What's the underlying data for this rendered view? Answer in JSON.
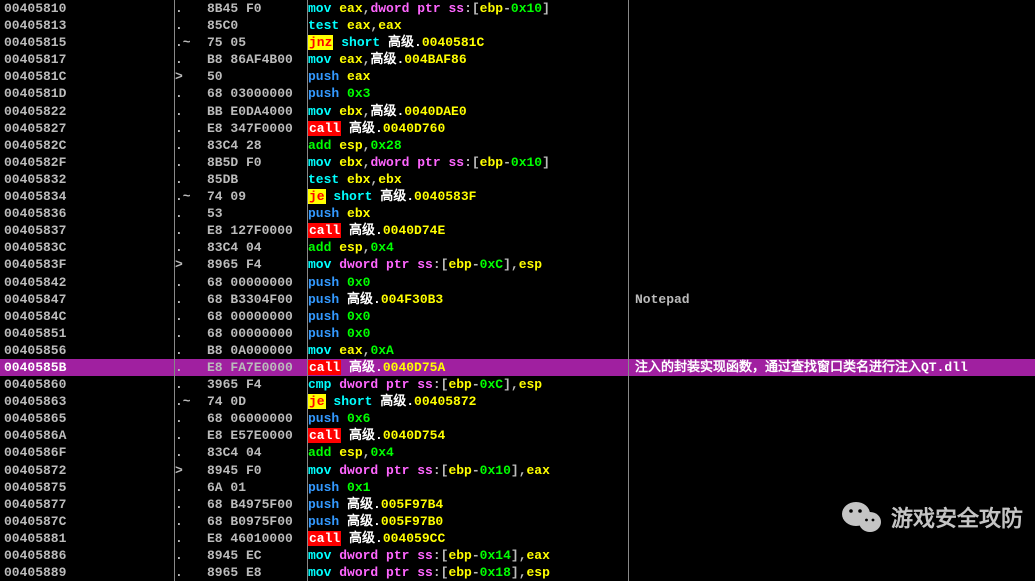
{
  "rows": [
    {
      "addr": "00405810",
      "mark": ".",
      "bytes": "8B45 F0",
      "d": [
        [
          "cyan",
          "mov "
        ],
        [
          "yellow",
          "eax"
        ],
        [
          "gray",
          ","
        ],
        [
          "pink",
          "dword ptr ss"
        ],
        [
          "gray",
          ":["
        ],
        [
          "yellow",
          "ebp"
        ],
        [
          "gray",
          "-"
        ],
        [
          "green",
          "0x10"
        ],
        [
          "gray",
          "]"
        ]
      ],
      "c": ""
    },
    {
      "addr": "00405813",
      "mark": ".",
      "bytes": "85C0",
      "d": [
        [
          "cyan",
          "test "
        ],
        [
          "yellow",
          "eax"
        ],
        [
          "gray",
          ","
        ],
        [
          "yellow",
          "eax"
        ]
      ],
      "c": ""
    },
    {
      "addr": "00405815",
      "mark": ".~",
      "bytes": "75 05",
      "d": [
        [
          "box-jnz",
          "jnz"
        ],
        [
          "gray",
          " "
        ],
        [
          "cyan",
          "short "
        ],
        [
          "white",
          "高级."
        ],
        [
          "yellow",
          "0040581C"
        ]
      ],
      "c": ""
    },
    {
      "addr": "00405817",
      "mark": ".",
      "bytes": "B8 86AF4B00",
      "d": [
        [
          "cyan",
          "mov "
        ],
        [
          "yellow",
          "eax"
        ],
        [
          "gray",
          ","
        ],
        [
          "white",
          "高级."
        ],
        [
          "yellow",
          "004BAF86"
        ]
      ],
      "c": ""
    },
    {
      "addr": "0040581C",
      "mark": ">",
      "bytes": "50",
      "d": [
        [
          "blue",
          "push "
        ],
        [
          "yellow",
          "eax"
        ]
      ],
      "c": ""
    },
    {
      "addr": "0040581D",
      "mark": ".",
      "bytes": "68 03000000",
      "d": [
        [
          "blue",
          "push "
        ],
        [
          "green",
          "0x3"
        ]
      ],
      "c": ""
    },
    {
      "addr": "00405822",
      "mark": ".",
      "bytes": "BB E0DA4000",
      "d": [
        [
          "cyan",
          "mov "
        ],
        [
          "yellow",
          "ebx"
        ],
        [
          "gray",
          ","
        ],
        [
          "white",
          "高级."
        ],
        [
          "yellow",
          "0040DAE0"
        ]
      ],
      "c": ""
    },
    {
      "addr": "00405827",
      "mark": ".",
      "bytes": "E8 347F0000",
      "d": [
        [
          "box-call",
          "call"
        ],
        [
          "gray",
          " "
        ],
        [
          "white",
          "高级."
        ],
        [
          "yellow",
          "0040D760"
        ]
      ],
      "c": ""
    },
    {
      "addr": "0040582C",
      "mark": ".",
      "bytes": "83C4 28",
      "d": [
        [
          "green",
          "add "
        ],
        [
          "yellow",
          "esp"
        ],
        [
          "gray",
          ","
        ],
        [
          "green",
          "0x28"
        ]
      ],
      "c": ""
    },
    {
      "addr": "0040582F",
      "mark": ".",
      "bytes": "8B5D F0",
      "d": [
        [
          "cyan",
          "mov "
        ],
        [
          "yellow",
          "ebx"
        ],
        [
          "gray",
          ","
        ],
        [
          "pink",
          "dword ptr ss"
        ],
        [
          "gray",
          ":["
        ],
        [
          "yellow",
          "ebp"
        ],
        [
          "gray",
          "-"
        ],
        [
          "green",
          "0x10"
        ],
        [
          "gray",
          "]"
        ]
      ],
      "c": ""
    },
    {
      "addr": "00405832",
      "mark": ".",
      "bytes": "85DB",
      "d": [
        [
          "cyan",
          "test "
        ],
        [
          "yellow",
          "ebx"
        ],
        [
          "gray",
          ","
        ],
        [
          "yellow",
          "ebx"
        ]
      ],
      "c": ""
    },
    {
      "addr": "00405834",
      "mark": ".~",
      "bytes": "74 09",
      "d": [
        [
          "box-je",
          "je"
        ],
        [
          "gray",
          " "
        ],
        [
          "cyan",
          "short "
        ],
        [
          "white",
          "高级."
        ],
        [
          "yellow",
          "0040583F"
        ]
      ],
      "c": ""
    },
    {
      "addr": "00405836",
      "mark": ".",
      "bytes": "53",
      "d": [
        [
          "blue",
          "push "
        ],
        [
          "yellow",
          "ebx"
        ]
      ],
      "c": ""
    },
    {
      "addr": "00405837",
      "mark": ".",
      "bytes": "E8 127F0000",
      "d": [
        [
          "box-call",
          "call"
        ],
        [
          "gray",
          " "
        ],
        [
          "white",
          "高级."
        ],
        [
          "yellow",
          "0040D74E"
        ]
      ],
      "c": ""
    },
    {
      "addr": "0040583C",
      "mark": ".",
      "bytes": "83C4 04",
      "d": [
        [
          "green",
          "add "
        ],
        [
          "yellow",
          "esp"
        ],
        [
          "gray",
          ","
        ],
        [
          "green",
          "0x4"
        ]
      ],
      "c": ""
    },
    {
      "addr": "0040583F",
      "mark": ">",
      "bytes": "8965 F4",
      "d": [
        [
          "cyan",
          "mov "
        ],
        [
          "pink",
          "dword ptr ss"
        ],
        [
          "gray",
          ":["
        ],
        [
          "yellow",
          "ebp"
        ],
        [
          "gray",
          "-"
        ],
        [
          "green",
          "0xC"
        ],
        [
          "gray",
          "],"
        ],
        [
          "yellow",
          "esp"
        ]
      ],
      "c": ""
    },
    {
      "addr": "00405842",
      "mark": ".",
      "bytes": "68 00000000",
      "d": [
        [
          "blue",
          "push "
        ],
        [
          "green",
          "0x0"
        ]
      ],
      "c": ""
    },
    {
      "addr": "00405847",
      "mark": ".",
      "bytes": "68 B3304F00",
      "d": [
        [
          "blue",
          "push "
        ],
        [
          "white",
          "高级."
        ],
        [
          "yellow",
          "004F30B3"
        ]
      ],
      "c": "Notepad"
    },
    {
      "addr": "0040584C",
      "mark": ".",
      "bytes": "68 00000000",
      "d": [
        [
          "blue",
          "push "
        ],
        [
          "green",
          "0x0"
        ]
      ],
      "c": ""
    },
    {
      "addr": "00405851",
      "mark": ".",
      "bytes": "68 00000000",
      "d": [
        [
          "blue",
          "push "
        ],
        [
          "green",
          "0x0"
        ]
      ],
      "c": ""
    },
    {
      "addr": "00405856",
      "mark": ".",
      "bytes": "B8 0A000000",
      "d": [
        [
          "cyan",
          "mov "
        ],
        [
          "yellow",
          "eax"
        ],
        [
          "gray",
          ","
        ],
        [
          "green",
          "0xA"
        ]
      ],
      "c": ""
    },
    {
      "addr": "0040585B",
      "mark": ".",
      "bytes": "E8 FA7E0000",
      "hl": true,
      "d": [
        [
          "box-call",
          "call"
        ],
        [
          "gray",
          " "
        ],
        [
          "white",
          "高级."
        ],
        [
          "yellow",
          "0040D75A"
        ]
      ],
      "c": "注入的封装实现函数，通过查找窗口类名进行注入QT.dll"
    },
    {
      "addr": "00405860",
      "mark": ".",
      "bytes": "3965 F4",
      "d": [
        [
          "cyan",
          "cmp "
        ],
        [
          "pink",
          "dword ptr ss"
        ],
        [
          "gray",
          ":["
        ],
        [
          "yellow",
          "ebp"
        ],
        [
          "gray",
          "-"
        ],
        [
          "green",
          "0xC"
        ],
        [
          "gray",
          "],"
        ],
        [
          "yellow",
          "esp"
        ]
      ],
      "c": ""
    },
    {
      "addr": "00405863",
      "mark": ".~",
      "bytes": "74 0D",
      "d": [
        [
          "box-je",
          "je"
        ],
        [
          "gray",
          " "
        ],
        [
          "cyan",
          "short "
        ],
        [
          "white",
          "高级."
        ],
        [
          "yellow",
          "00405872"
        ]
      ],
      "c": ""
    },
    {
      "addr": "00405865",
      "mark": ".",
      "bytes": "68 06000000",
      "d": [
        [
          "blue",
          "push "
        ],
        [
          "green",
          "0x6"
        ]
      ],
      "c": ""
    },
    {
      "addr": "0040586A",
      "mark": ".",
      "bytes": "E8 E57E0000",
      "d": [
        [
          "box-call",
          "call"
        ],
        [
          "gray",
          " "
        ],
        [
          "white",
          "高级."
        ],
        [
          "yellow",
          "0040D754"
        ]
      ],
      "c": ""
    },
    {
      "addr": "0040586F",
      "mark": ".",
      "bytes": "83C4 04",
      "d": [
        [
          "green",
          "add "
        ],
        [
          "yellow",
          "esp"
        ],
        [
          "gray",
          ","
        ],
        [
          "green",
          "0x4"
        ]
      ],
      "c": ""
    },
    {
      "addr": "00405872",
      "mark": ">",
      "bytes": "8945 F0",
      "d": [
        [
          "cyan",
          "mov "
        ],
        [
          "pink",
          "dword ptr ss"
        ],
        [
          "gray",
          ":["
        ],
        [
          "yellow",
          "ebp"
        ],
        [
          "gray",
          "-"
        ],
        [
          "green",
          "0x10"
        ],
        [
          "gray",
          "],"
        ],
        [
          "yellow",
          "eax"
        ]
      ],
      "c": ""
    },
    {
      "addr": "00405875",
      "mark": ".",
      "bytes": "6A 01",
      "d": [
        [
          "blue",
          "push "
        ],
        [
          "green",
          "0x1"
        ]
      ],
      "c": ""
    },
    {
      "addr": "00405877",
      "mark": ".",
      "bytes": "68 B4975F00",
      "d": [
        [
          "blue",
          "push "
        ],
        [
          "white",
          "高级."
        ],
        [
          "yellow",
          "005F97B4"
        ]
      ],
      "c": ""
    },
    {
      "addr": "0040587C",
      "mark": ".",
      "bytes": "68 B0975F00",
      "d": [
        [
          "blue",
          "push "
        ],
        [
          "white",
          "高级."
        ],
        [
          "yellow",
          "005F97B0"
        ]
      ],
      "c": ""
    },
    {
      "addr": "00405881",
      "mark": ".",
      "bytes": "E8 46010000",
      "d": [
        [
          "box-call",
          "call"
        ],
        [
          "gray",
          " "
        ],
        [
          "white",
          "高级."
        ],
        [
          "yellow",
          "004059CC"
        ]
      ],
      "c": ""
    },
    {
      "addr": "00405886",
      "mark": ".",
      "bytes": "8945 EC",
      "d": [
        [
          "cyan",
          "mov "
        ],
        [
          "pink",
          "dword ptr ss"
        ],
        [
          "gray",
          ":["
        ],
        [
          "yellow",
          "ebp"
        ],
        [
          "gray",
          "-"
        ],
        [
          "green",
          "0x14"
        ],
        [
          "gray",
          "],"
        ],
        [
          "yellow",
          "eax"
        ]
      ],
      "c": ""
    },
    {
      "addr": "00405889",
      "mark": ".",
      "bytes": "8965 E8",
      "d": [
        [
          "cyan",
          "mov "
        ],
        [
          "pink",
          "dword ptr ss"
        ],
        [
          "gray",
          ":["
        ],
        [
          "yellow",
          "ebp"
        ],
        [
          "gray",
          "-"
        ],
        [
          "green",
          "0x18"
        ],
        [
          "gray",
          "],"
        ],
        [
          "yellow",
          "esp"
        ]
      ],
      "c": ""
    }
  ],
  "watermark": "游戏安全攻防"
}
